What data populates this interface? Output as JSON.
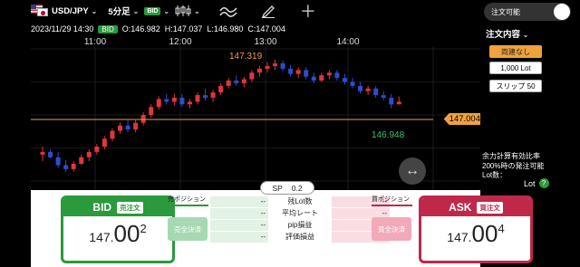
{
  "toolbar": {
    "pair": "USD/JPY",
    "timeframe": "5分足",
    "bid_tag": "BID"
  },
  "chart": {
    "ohlc_date": "2023/11/29 14:30",
    "ohlc_tag": "BID",
    "ohlc_o": "O:146.982",
    "ohlc_h": "H:147.037",
    "ohlc_l": "L:146.980",
    "ohlc_c": "C:147.004",
    "time_labels": [
      "11:00",
      "12:00",
      "13:00",
      "14:00"
    ],
    "high_label": "147.319",
    "low_label": "146.948",
    "current_price": "147.004",
    "colors": {
      "up": "#e0353b",
      "down": "#2f4ccc",
      "price_line": "#f0a23c",
      "grid": "#2e2e2e"
    },
    "candles": [
      [
        146.6,
        146.66,
        146.55,
        146.62
      ],
      [
        146.62,
        146.64,
        146.57,
        146.58
      ],
      [
        146.58,
        146.62,
        146.5,
        146.52
      ],
      [
        146.52,
        146.56,
        146.47,
        146.49
      ],
      [
        146.49,
        146.55,
        146.47,
        146.53
      ],
      [
        146.53,
        146.6,
        146.52,
        146.58
      ],
      [
        146.58,
        146.64,
        146.55,
        146.62
      ],
      [
        146.62,
        146.68,
        146.6,
        146.66
      ],
      [
        146.66,
        146.74,
        146.64,
        146.72
      ],
      [
        146.72,
        146.8,
        146.7,
        146.78
      ],
      [
        146.78,
        146.84,
        146.76,
        146.82
      ],
      [
        146.82,
        146.86,
        146.77,
        146.79
      ],
      [
        146.79,
        146.86,
        146.77,
        146.84
      ],
      [
        146.84,
        146.92,
        146.82,
        146.9
      ],
      [
        146.9,
        146.98,
        146.88,
        146.96
      ],
      [
        146.96,
        147.04,
        146.94,
        147.02
      ],
      [
        147.02,
        147.06,
        146.98,
        147.0
      ],
      [
        147.0,
        147.06,
        146.97,
        147.03
      ],
      [
        147.03,
        147.06,
        146.96,
        146.98
      ],
      [
        146.98,
        147.02,
        146.95,
        147.0
      ],
      [
        147.0,
        147.07,
        146.98,
        147.05
      ],
      [
        147.05,
        147.1,
        147.01,
        147.03
      ],
      [
        147.03,
        147.09,
        147.0,
        147.07
      ],
      [
        147.07,
        147.14,
        147.05,
        147.12
      ],
      [
        147.12,
        147.18,
        147.1,
        147.16
      ],
      [
        147.16,
        147.2,
        147.12,
        147.14
      ],
      [
        147.14,
        147.19,
        147.11,
        147.17
      ],
      [
        147.17,
        147.24,
        147.15,
        147.22
      ],
      [
        147.22,
        147.27,
        147.19,
        147.25
      ],
      [
        147.25,
        147.3,
        147.22,
        147.27
      ],
      [
        147.27,
        147.32,
        147.24,
        147.29
      ],
      [
        147.29,
        147.31,
        147.23,
        147.25
      ],
      [
        147.25,
        147.28,
        147.19,
        147.21
      ],
      [
        147.21,
        147.26,
        147.18,
        147.24
      ],
      [
        147.24,
        147.26,
        147.17,
        147.19
      ],
      [
        147.19,
        147.22,
        147.14,
        147.16
      ],
      [
        147.16,
        147.22,
        147.15,
        147.2
      ],
      [
        147.2,
        147.24,
        147.17,
        147.22
      ],
      [
        147.22,
        147.24,
        147.16,
        147.18
      ],
      [
        147.18,
        147.21,
        147.13,
        147.15
      ],
      [
        147.15,
        147.18,
        147.1,
        147.12
      ],
      [
        147.12,
        147.15,
        147.06,
        147.08
      ],
      [
        147.08,
        147.12,
        147.05,
        147.1
      ],
      [
        147.1,
        147.12,
        147.03,
        147.05
      ],
      [
        147.05,
        147.08,
        147.01,
        147.03
      ],
      [
        147.03,
        147.06,
        146.95,
        146.98
      ],
      [
        146.98,
        147.04,
        146.98,
        147.0
      ]
    ]
  },
  "panel": {
    "toggle_label": "注文可能",
    "order_head": "注文内容",
    "opt1": "両建なし",
    "opt2": "1,000 Lot",
    "opt3": "スリップ 50",
    "note1": "余力計算有効比率",
    "note2": "200%時の発注可能",
    "note3": "Lot数：",
    "lot_label": "Lot",
    "help": "?"
  },
  "trade": {
    "sp_label": "SP",
    "sp_value": "0.2",
    "bid_head": "BID",
    "bid_sub": "売注文",
    "bid_small": "147.",
    "bid_big": "00",
    "bid_sup": "2",
    "ask_head": "ASK",
    "ask_sub": "買注文",
    "ask_small": "147.",
    "ask_big": "00",
    "ask_sup": "4",
    "sell_pos": "売ポジション",
    "buy_pos": "買ポジション",
    "sell_settle": "売全決済",
    "buy_settle": "買全決済",
    "rows": [
      {
        "l": "--",
        "c": "残Lot数",
        "r": "--"
      },
      {
        "l": "--",
        "c": "平均レート",
        "r": "--"
      },
      {
        "l": "--",
        "c": "pip損益",
        "r": "--"
      },
      {
        "l": "--",
        "c": "評価損益",
        "r": "--"
      }
    ]
  }
}
